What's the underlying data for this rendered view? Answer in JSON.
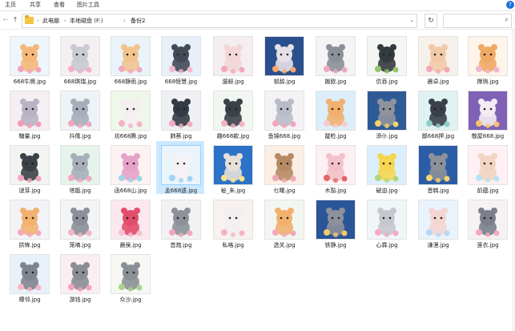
{
  "ribbon": {
    "tabs": [
      "主页",
      "共享",
      "查看",
      "图片工具"
    ],
    "help": "?"
  },
  "nav": {
    "back": "←",
    "forward": "→",
    "up": "↑",
    "recent": "⌄",
    "breadcrumb": [
      "此电脑",
      "本地磁盘 (F:)",
      "备份2"
    ],
    "separator": "›",
    "refresh": "↻",
    "search_icon": "⌕"
  },
  "files": [
    {
      "name": "668牛牌.jpg",
      "bg": "#eef6fb",
      "face": "#f4b979",
      "flower": "#f3a3bf"
    },
    {
      "name": "668琪瑞.jpg",
      "bg": "#f4f0f2",
      "face": "#c9c9d3",
      "flower": "#f4b0c6"
    },
    {
      "name": "668静雨.jpg",
      "bg": "#e9f4fa",
      "face": "#f1c38f",
      "flower": "#f2a8c0"
    },
    {
      "name": "668惬慧.jpg",
      "bg": "#e7f0f8",
      "face": "#444a55",
      "flower": "#f6b7c9"
    },
    {
      "name": "遛蚜.jpg",
      "bg": "#f5eef0",
      "face": "#f3d6d8",
      "flower": "#f3a7bb"
    },
    {
      "name": "邬鸹.jpg",
      "bg": "#2a4f8d",
      "face": "#e6e0e8",
      "flower": "#f7a96a"
    },
    {
      "name": "搬欧.jpg",
      "bg": "#f4f4f4",
      "face": "#8a8f99",
      "flower": "#f0a6be"
    },
    {
      "name": "伉吞.jpg",
      "bg": "#f3f6f2",
      "face": "#333a40",
      "flower": "#93c66a"
    },
    {
      "name": "晨卓.jpg",
      "bg": "#f6f1ea",
      "face": "#f2c9a8",
      "flower": "#f2a7b8"
    },
    {
      "name": "撑驹.jpg",
      "bg": "#fff4e9",
      "face": "#f0a965",
      "flower": "#f1b7cf"
    },
    {
      "name": "糖量.jpg",
      "bg": "#f5eef3",
      "face": "#b7b3c4",
      "flower": "#f19ab7"
    },
    {
      "name": "抖儒.jpg",
      "bg": "#eef3f7",
      "face": "#a6aeb9",
      "flower": "#f2a5bd"
    },
    {
      "name": "坊668腾.jpg",
      "bg": "#eef7ea",
      "face": "#f6eef2",
      "flower": "#f4b2c7"
    },
    {
      "name": "肺蔡.jpg",
      "bg": "#eef0f3",
      "face": "#343a44",
      "flower": "#f4a9c0"
    },
    {
      "name": "趣668款.jpg",
      "bg": "#f2f6f1",
      "face": "#3b4148",
      "flower": "#f5b0c2"
    },
    {
      "name": "鱼锦668.jpg",
      "bg": "#f4f2f5",
      "face": "#b9bcc8",
      "flower": "#f5a4bb"
    },
    {
      "name": "靛睑.jpg",
      "bg": "#dbeefa",
      "face": "#f1b06e",
      "flower": "#f7c9d2"
    },
    {
      "name": "添仆.jpg",
      "bg": "#2e5a95",
      "face": "#8e939c",
      "flower": "#f6d36a"
    },
    {
      "name": "鄙668押.jpg",
      "bg": "#dff2f1",
      "face": "#39404a",
      "flower": "#8fd0c3"
    },
    {
      "name": "敬屋668.jpg",
      "bg": "#7f62b6",
      "face": "#f3ecf4",
      "flower": "#f6c36b"
    },
    {
      "name": "谜芽.jpg",
      "bg": "#f1f4f1",
      "face": "#3b4148",
      "flower": "#f3a6bd"
    },
    {
      "name": "塔甑.jpg",
      "bg": "#e6f3ea",
      "face": "#a8aeb8",
      "flower": "#f2a7c1"
    },
    {
      "name": "函668山.jpg",
      "bg": "#fdf2f2",
      "face": "#e6a2c8",
      "flower": "#9dd6e8"
    },
    {
      "name": "孟668遗.jpg",
      "bg": "#e9f4fb",
      "face": "#f5f2f6",
      "flower": "#9fd2f3"
    },
    {
      "name": "秘_朱.jpg",
      "bg": "#2c72c7",
      "face": "#e6e0d9",
      "flower": "#fbe28d"
    },
    {
      "name": "乜曙.jpg",
      "bg": "#fbeee5",
      "face": "#b88a64",
      "flower": "#f2a7b8"
    },
    {
      "name": "木豁.jpg",
      "bg": "#fdf0f2",
      "face": "#f2c1c9",
      "flower": "#e56565"
    },
    {
      "name": "破迫.jpg",
      "bg": "#dcefff",
      "face": "#f6d54f",
      "flower": "#b0d67a"
    },
    {
      "name": "晋韩.jpg",
      "bg": "#2b5da6",
      "face": "#8c919a",
      "flower": "#f7d46e"
    },
    {
      "name": "前蕴.jpg",
      "bg": "#fff0f3",
      "face": "#f1d4c1",
      "flower": "#b6e3f3"
    },
    {
      "name": "拱锋.jpg",
      "bg": "#f2f3f6",
      "face": "#f2b16f",
      "flower": "#f3a7bd"
    },
    {
      "name": "笼墒.jpg",
      "bg": "#f3f4f5",
      "face": "#8a8f99",
      "flower": "#f4b3c6"
    },
    {
      "name": "晨侯.jpg",
      "bg": "#fbe8ef",
      "face": "#e24d6b",
      "flower": "#f6c1d0"
    },
    {
      "name": "首炮.jpg",
      "bg": "#f2f2f4",
      "face": "#8d919a",
      "flower": "#f2a7bb"
    },
    {
      "name": "私咯.jpg",
      "bg": "#f7f2f0",
      "face": "#f2eef2",
      "flower": "#f5b2c4"
    },
    {
      "name": "选关.jpg",
      "bg": "#f2f6f1",
      "face": "#f2b16c",
      "flower": "#f3a7bd"
    },
    {
      "name": "铁静.jpg",
      "bg": "#2a5599",
      "face": "#8d919b",
      "flower": "#f6ca67"
    },
    {
      "name": "心霖.jpg",
      "bg": "#f0f6f8",
      "face": "#c6c6cf",
      "flower": "#f3a9c1"
    },
    {
      "name": "谦浬.jpg",
      "bg": "#e9f3fb",
      "face": "#f3d5d1",
      "flower": "#b7d7f3"
    },
    {
      "name": "莲衣.jpg",
      "bg": "#f6f2f4",
      "face": "#7a7f89",
      "flower": "#f3aac0"
    },
    {
      "name": "樽邻.jpg",
      "bg": "#e8f1fa",
      "face": "#7f848e",
      "flower": "#f6b6c7"
    },
    {
      "name": "游钱.jpg",
      "bg": "#fbeef2",
      "face": "#888d96",
      "flower": "#f4a1b9"
    },
    {
      "name": "众沙.jpg",
      "bg": "#f7f7f4",
      "face": "#8b8f98",
      "flower": "#a7d58c"
    }
  ]
}
